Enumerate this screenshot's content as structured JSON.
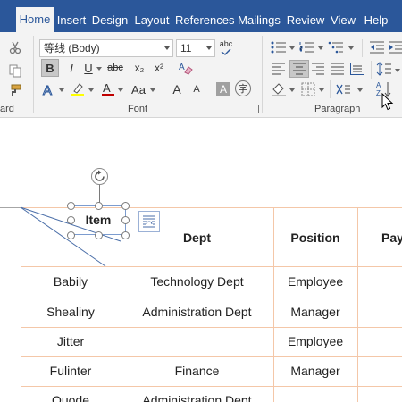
{
  "ribbon_tabs": [
    {
      "label": "Home",
      "active": true
    },
    {
      "label": "Insert"
    },
    {
      "label": "Design"
    },
    {
      "label": "Layout"
    },
    {
      "label": "References"
    },
    {
      "label": "Mailings"
    },
    {
      "label": "Review"
    },
    {
      "label": "View"
    },
    {
      "label": "Help"
    }
  ],
  "font_group": {
    "font_name": "等线 (Body)",
    "font_size": "11",
    "label": "Font",
    "buttons": {
      "bold": "B",
      "italic": "I",
      "underline": "U",
      "strikethrough": "abc",
      "subscript": "x₂",
      "superscript": "x²",
      "change_case": "Aa",
      "grow": "A",
      "shrink": "A",
      "char_shading": "A",
      "phonetic": "字"
    }
  },
  "clipboard_group": {
    "label_partial": "ard"
  },
  "paragraph_group": {
    "label": "Paragraph"
  },
  "colors": {
    "tab_bar": "#2b579a",
    "highlight": "#ffff00",
    "font_color": "#c00000",
    "table_border": "#f4c7a8"
  },
  "table": {
    "headers": [
      "Item",
      "Dept",
      "Position",
      "Pay"
    ],
    "rows": [
      [
        "Babily",
        "Technology Dept",
        "Employee"
      ],
      [
        "Shealiny",
        "Administration Dept",
        "Manager"
      ],
      [
        "Jitter",
        "",
        "Employee"
      ],
      [
        "Fulinter",
        "Finance",
        "Manager"
      ],
      [
        "Quode",
        "Administration Dept",
        ""
      ]
    ]
  }
}
